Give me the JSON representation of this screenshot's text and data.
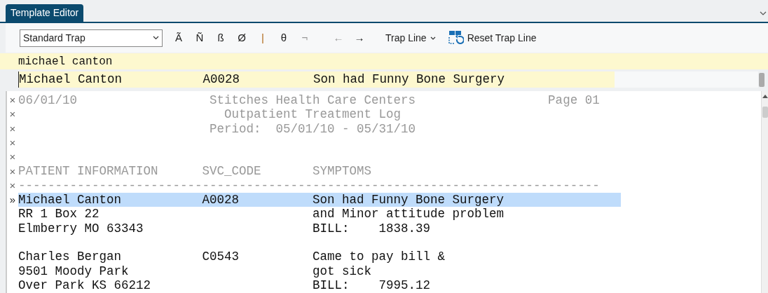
{
  "tab": {
    "label": "Template Editor",
    "selected": true
  },
  "toolbar": {
    "trap_select": "Standard Trap",
    "symbols": [
      "Ã",
      "Ñ",
      "ß",
      "Ø",
      "|",
      "θ",
      "¬",
      "←",
      "→"
    ],
    "trap_line_menu": "Trap Line",
    "reset_button": "Reset Trap Line"
  },
  "search": {
    "value": "michael canton"
  },
  "match_line": "Michael Canton           A0028          Son had Funny Bone Surgery",
  "report_lines": [
    {
      "text": "06/01/10                  Stitches Health Care Centers                  Page 01",
      "kind": "header",
      "marker": "×",
      "selected": false
    },
    {
      "text": "                            Outpatient Treatment Log",
      "kind": "header",
      "marker": "×",
      "selected": false
    },
    {
      "text": "                          Period:  05/01/10 - 05/31/10",
      "kind": "header",
      "marker": "×",
      "selected": false
    },
    {
      "kind": "header",
      "marker": "×",
      "selected": false
    },
    {
      "kind": "header",
      "marker": "×",
      "selected": false
    },
    {
      "text": "PATIENT INFORMATION      SVC_CODE       SYMPTOMS",
      "kind": "header",
      "marker": "×",
      "selected": false
    },
    {
      "text": "-------------------------------------------------------------------------------",
      "kind": "header",
      "marker": "×",
      "selected": false
    },
    {
      "text": "Michael Canton           A0028          Son had Funny Bone Surgery",
      "kind": "data",
      "marker": "»",
      "selected": true
    },
    {
      "text": "RR 1 Box 22                             and Minor attitude problem",
      "kind": "data",
      "selected": false
    },
    {
      "text": "Elmberry MO 63343                       BILL:    1838.39",
      "kind": "data",
      "selected": false
    },
    {
      "kind": "data",
      "selected": false
    },
    {
      "text": "Charles Bergan           C0543          Came to pay bill &",
      "kind": "data",
      "selected": false
    },
    {
      "text": "9501 Moody Park                         got sick",
      "kind": "data",
      "selected": false
    },
    {
      "text": "Over Park KS 66212                      BILL:    7995.12",
      "kind": "data",
      "selected": false
    }
  ]
}
